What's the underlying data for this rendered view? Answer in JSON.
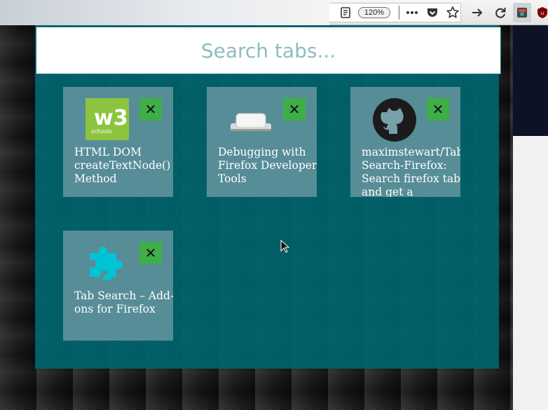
{
  "toolbar": {
    "zoom": "120%",
    "icons": [
      "reader-view-icon",
      "more-dots-icon",
      "pocket-icon",
      "bookmark-star-icon",
      "forward-arrow-icon",
      "reload-icon",
      "tab-search-extension-icon",
      "ublock-icon"
    ]
  },
  "search": {
    "placeholder": "Search tabs...",
    "value": ""
  },
  "tabs": [
    {
      "title": "HTML DOM createTextNode() Method",
      "favicon": "w3schools-logo-icon"
    },
    {
      "title": "Debugging with Firefox Developer Tools",
      "favicon": "white-pill-icon"
    },
    {
      "title": "maximstewart/Tab-Search-Firefox: Search firefox tabs and get a",
      "favicon": "github-octocat-icon"
    },
    {
      "title": "Tab Search – Add-ons for Firefox",
      "favicon": "puzzle-piece-icon"
    }
  ],
  "close_label": "✕",
  "colors": {
    "panel": "#00646e",
    "close_button": "#3fae49",
    "card": "#78a0aa"
  }
}
